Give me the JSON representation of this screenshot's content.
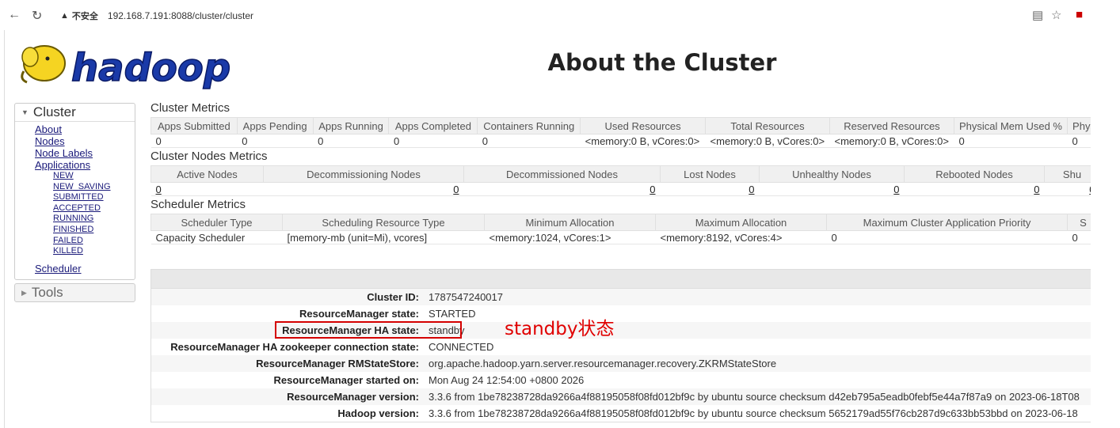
{
  "browser": {
    "back_icon": "back-arrow-icon",
    "reload_icon": "reload-icon",
    "security_label": "不安全",
    "url": "192.168.7.191:8088/cluster/cluster"
  },
  "page": {
    "logo_text": "hadoop",
    "title": "About the Cluster"
  },
  "sidebar": {
    "cluster_label": "Cluster",
    "links": [
      "About",
      "Nodes",
      "Node Labels",
      "Applications"
    ],
    "app_states": [
      "NEW",
      "NEW_SAVING",
      "SUBMITTED",
      "ACCEPTED",
      "RUNNING",
      "FINISHED",
      "FAILED",
      "KILLED"
    ],
    "scheduler_label": "Scheduler",
    "tools_label": "Tools"
  },
  "cluster_metrics": {
    "title": "Cluster Metrics",
    "headers": [
      "Apps Submitted",
      "Apps Pending",
      "Apps Running",
      "Apps Completed",
      "Containers Running",
      "Used Resources",
      "Total Resources",
      "Reserved Resources",
      "Physical Mem Used %",
      "Phys"
    ],
    "values": [
      "0",
      "0",
      "0",
      "0",
      "0",
      "<memory:0 B, vCores:0>",
      "<memory:0 B, vCores:0>",
      "<memory:0 B, vCores:0>",
      "0",
      "0"
    ]
  },
  "node_metrics": {
    "title": "Cluster Nodes Metrics",
    "headers": [
      "Active Nodes",
      "Decommissioning Nodes",
      "Decommissioned Nodes",
      "Lost Nodes",
      "Unhealthy Nodes",
      "Rebooted Nodes",
      "Shu"
    ],
    "values": [
      "0",
      "0",
      "0",
      "0",
      "0",
      "0",
      "0"
    ]
  },
  "scheduler_metrics": {
    "title": "Scheduler Metrics",
    "headers": [
      "Scheduler Type",
      "Scheduling Resource Type",
      "Minimum Allocation",
      "Maximum Allocation",
      "Maximum Cluster Application Priority",
      "S"
    ],
    "values": [
      "Capacity Scheduler",
      "[memory-mb (unit=Mi), vcores]",
      "<memory:1024, vCores:1>",
      "<memory:8192, vCores:4>",
      "0",
      "0"
    ]
  },
  "cluster_info": [
    {
      "key": "Cluster ID:",
      "value": "1787547240017"
    },
    {
      "key": "ResourceManager state:",
      "value": "STARTED"
    },
    {
      "key": "ResourceManager HA state:",
      "value": "standby"
    },
    {
      "key": "ResourceManager HA zookeeper connection state:",
      "value": "CONNECTED"
    },
    {
      "key": "ResourceManager RMStateStore:",
      "value": "org.apache.hadoop.yarn.server.resourcemanager.recovery.ZKRMStateStore"
    },
    {
      "key": "ResourceManager started on:",
      "value": "Mon Aug 24 12:54:00 +0800 2026"
    },
    {
      "key": "ResourceManager version:",
      "value": "3.3.6 from 1be78238728da9266a4f88195058f08fd012bf9c by ubuntu source checksum d42eb795a5eadb0febf5e44a7f87a9 on 2023-06-18T08"
    },
    {
      "key": "Hadoop version:",
      "value": "3.3.6 from 1be78238728da9266a4f88195058f08fd012bf9c by ubuntu source checksum 5652179ad55f76cb287d9c633bb53bbd on 2023-06-18"
    }
  ],
  "annotation": {
    "text": "standby状态",
    "color": "#e00000"
  }
}
